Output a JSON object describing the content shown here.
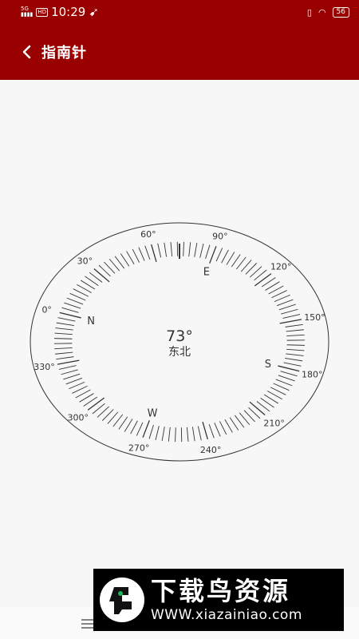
{
  "status_bar": {
    "network": "5G",
    "signal_label": "HD",
    "time": "10:29",
    "battery": "56"
  },
  "app_bar": {
    "title": "指南针",
    "back_icon": "chevron-left-icon"
  },
  "compass": {
    "heading_text": "73°",
    "direction_text": "东北",
    "heading_value": 73,
    "cardinals": [
      {
        "label": "N",
        "bearing": 0
      },
      {
        "label": "E",
        "bearing": 90
      },
      {
        "label": "S",
        "bearing": 180
      },
      {
        "label": "W",
        "bearing": 270
      }
    ],
    "degree_labels": [
      "0°",
      "30°",
      "60°",
      "90°",
      "120°",
      "150°",
      "180°",
      "210°",
      "240°",
      "270°",
      "300°",
      "330°"
    ],
    "colors": {
      "ring": "#333333",
      "text": "#333333",
      "accent": "#990000"
    }
  },
  "nav_bar": {
    "menu_icon": "menu-icon"
  },
  "watermark": {
    "title": "下载鸟资源",
    "url": "WWW.xiazainiao.com"
  }
}
